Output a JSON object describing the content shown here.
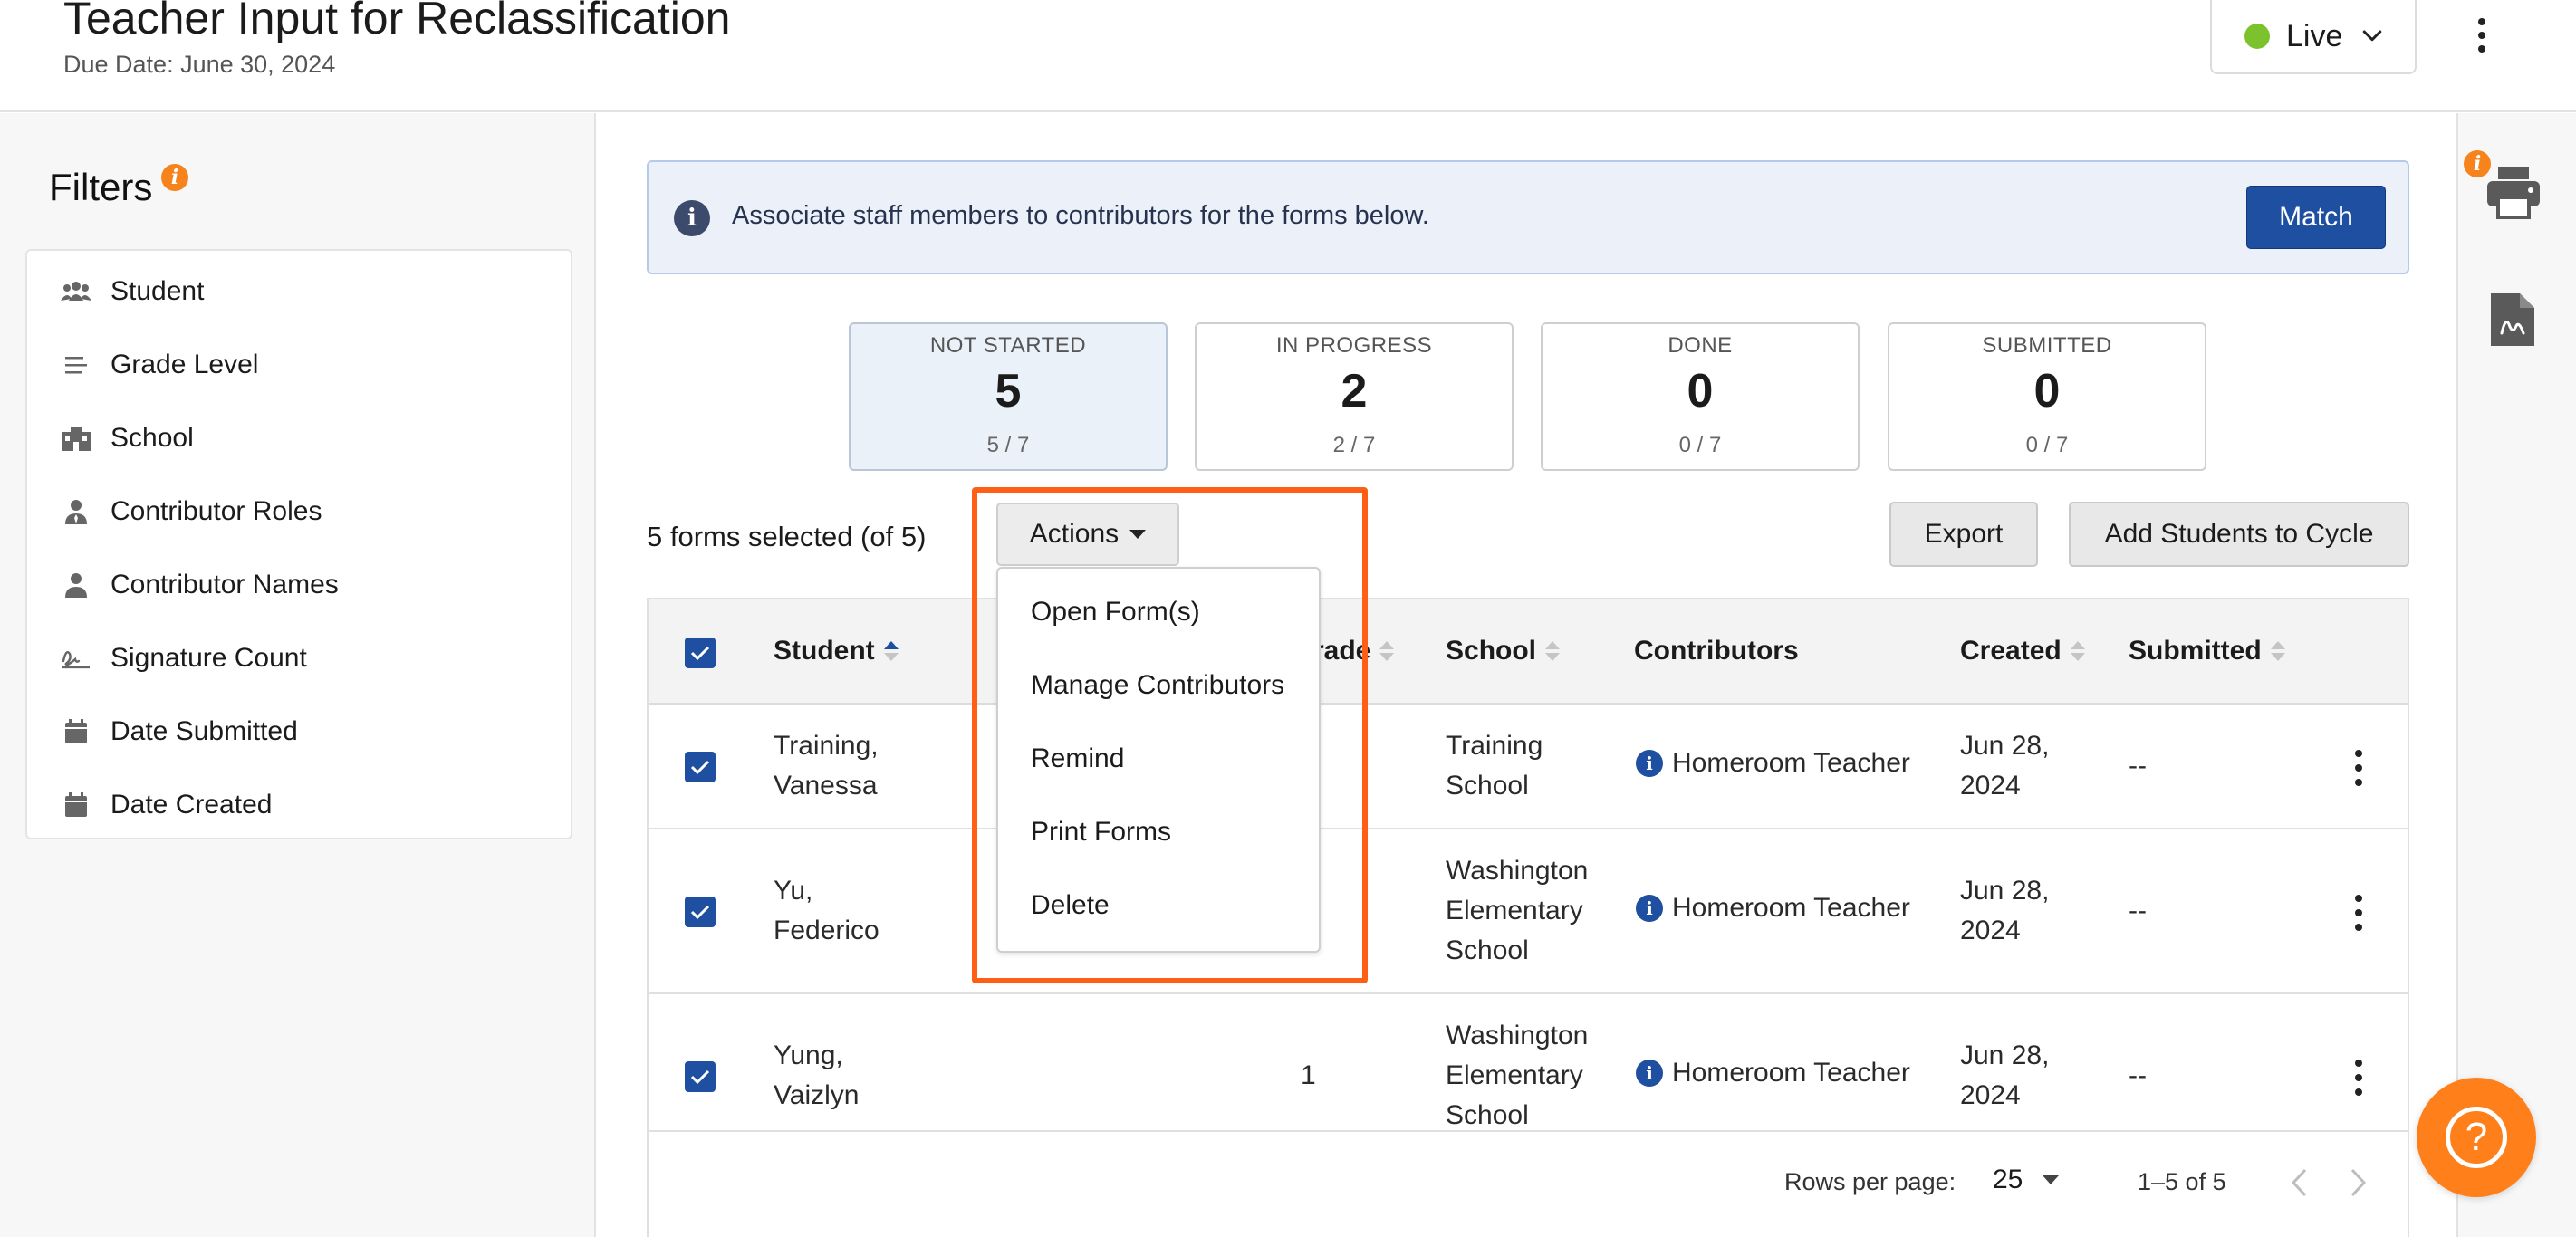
{
  "header": {
    "title": "Teacher Input for Reclassification",
    "due_date": "Due Date: June 30, 2024",
    "status": "Live",
    "status_color": "#7cc22d"
  },
  "filters": {
    "title": "Filters",
    "info_glyph": "i",
    "items": [
      {
        "label": "Student",
        "icon": "users-icon"
      },
      {
        "label": "Grade Level",
        "icon": "list-icon"
      },
      {
        "label": "School",
        "icon": "school-icon"
      },
      {
        "label": "Contributor Roles",
        "icon": "person-tie-icon"
      },
      {
        "label": "Contributor Names",
        "icon": "person-icon"
      },
      {
        "label": "Signature Count",
        "icon": "signature-icon"
      },
      {
        "label": "Date Submitted",
        "icon": "calendar-icon"
      },
      {
        "label": "Date Created",
        "icon": "calendar-icon"
      }
    ]
  },
  "banner": {
    "text": "Associate staff members to contributors for the forms below.",
    "button": "Match",
    "info_glyph": "i"
  },
  "stats": [
    {
      "title": "NOT STARTED",
      "value": "5",
      "sub": "5 / 7",
      "active": true
    },
    {
      "title": "IN PROGRESS",
      "value": "2",
      "sub": "2 / 7",
      "active": false
    },
    {
      "title": "DONE",
      "value": "0",
      "sub": "0 / 7",
      "active": false
    },
    {
      "title": "SUBMITTED",
      "value": "0",
      "sub": "0 / 7",
      "active": false
    }
  ],
  "toolbar": {
    "selected_text": "5 forms selected (of 5)",
    "actions_label": "Actions",
    "export_label": "Export",
    "add_label": "Add Students to Cycle"
  },
  "actions_menu": [
    "Open Form(s)",
    "Manage Contributors",
    "Remind",
    "Print Forms",
    "Delete"
  ],
  "table": {
    "columns": {
      "student": "Student",
      "grade": "rade",
      "school": "School",
      "contributors": "Contributors",
      "created": "Created",
      "submitted": "Submitted"
    },
    "rows": [
      {
        "student": [
          "Training,",
          "Vanessa"
        ],
        "grade": "",
        "school": [
          "Training",
          "School"
        ],
        "contributor": "Homeroom Teacher",
        "created": [
          "Jun 28,",
          "2024"
        ],
        "submitted": "--"
      },
      {
        "student": [
          "Yu,",
          "Federico"
        ],
        "grade": "",
        "school": [
          "Washington",
          "Elementary",
          "School"
        ],
        "contributor": "Homeroom Teacher",
        "created": [
          "Jun 28,",
          "2024"
        ],
        "submitted": "--"
      },
      {
        "student": [
          "Yung,",
          "Vaizlyn"
        ],
        "grade": "1",
        "school": [
          "Washington",
          "Elementary",
          "School"
        ],
        "contributor": "Homeroom Teacher",
        "created": [
          "Jun 28,",
          "2024"
        ],
        "submitted": "--"
      }
    ]
  },
  "pagination": {
    "rows_per_page_label": "Rows per page:",
    "rows_per_page": "25",
    "range": "1–5 of 5"
  },
  "right_rail": {
    "info_glyph": "i"
  },
  "help": {
    "glyph": "?"
  },
  "colors": {
    "primary": "#1e4fa0",
    "accent_orange": "#ff7f1a",
    "highlight": "#ff5f15",
    "banner_bg": "#ecf1f9"
  }
}
